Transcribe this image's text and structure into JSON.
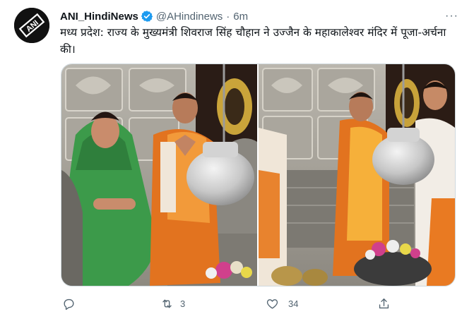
{
  "tweet": {
    "display_name": "ANI_HindiNews",
    "handle": "@AHindinews",
    "separator": "·",
    "time": "6m",
    "more": "···",
    "text": "मध्य प्रदेश: राज्य के मुख्यमंत्री शिवराज सिंह चौहान ने उज्जैन के महाकालेश्वर मंदिर में पूजा-अर्चना की।",
    "avatar_text": "ANI",
    "retweet_count": "3",
    "like_count": "34"
  },
  "icons": {
    "reply": "reply-icon",
    "retweet": "retweet-icon",
    "like": "like-icon",
    "share": "share-icon",
    "verified": "verified-badge-icon",
    "more": "more-icon"
  },
  "colors": {
    "verified_blue": "#1d9bf0",
    "secondary_text": "#536471",
    "primary_text": "#0f1419"
  }
}
